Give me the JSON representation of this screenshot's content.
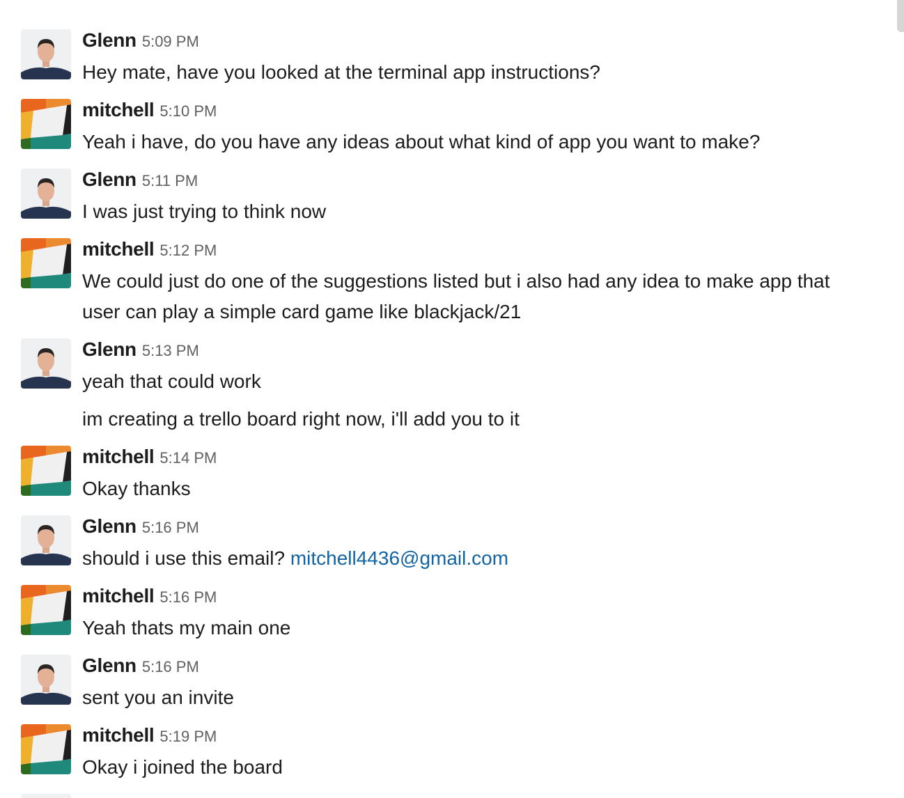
{
  "messages": [
    {
      "author": "Glenn",
      "time": "5:09 PM",
      "lines": [
        "Hey mate, have you looked at the terminal app instructions?"
      ]
    },
    {
      "author": "mitchell",
      "time": "5:10 PM",
      "lines": [
        "Yeah i have, do you have any ideas about what kind of app you want to make?"
      ]
    },
    {
      "author": "Glenn",
      "time": "5:11 PM",
      "lines": [
        "I was just trying to think now"
      ]
    },
    {
      "author": "mitchell",
      "time": "5:12 PM",
      "lines": [
        "We could just do one of the suggestions listed but i also had any idea to make app that",
        "user can play a simple card game like  blackjack/21"
      ]
    },
    {
      "author": "Glenn",
      "time": "5:13 PM",
      "lines": [
        "yeah that could work"
      ],
      "followup": "im creating a trello board right now, i'll add you to it"
    },
    {
      "author": "mitchell",
      "time": "5:14 PM",
      "lines": [
        "Okay thanks"
      ]
    },
    {
      "author": "Glenn",
      "time": "5:16 PM",
      "prefix": "should i use this email? ",
      "link": "mitchell4436@gmail.com"
    },
    {
      "author": "mitchell",
      "time": "5:16 PM",
      "lines": [
        "Yeah thats my main one"
      ]
    },
    {
      "author": "Glenn",
      "time": "5:16 PM",
      "lines": [
        "sent you an invite"
      ]
    },
    {
      "author": "mitchell",
      "time": "5:19 PM",
      "lines": [
        "Okay i joined the board"
      ]
    }
  ],
  "colors": {
    "link": "#1264a3",
    "timestamp": "#616061",
    "text": "#1d1c1d"
  },
  "icons": {
    "glenn_avatar": "user-photo-avatar",
    "mitchell_avatar": "identicon-avatar"
  }
}
